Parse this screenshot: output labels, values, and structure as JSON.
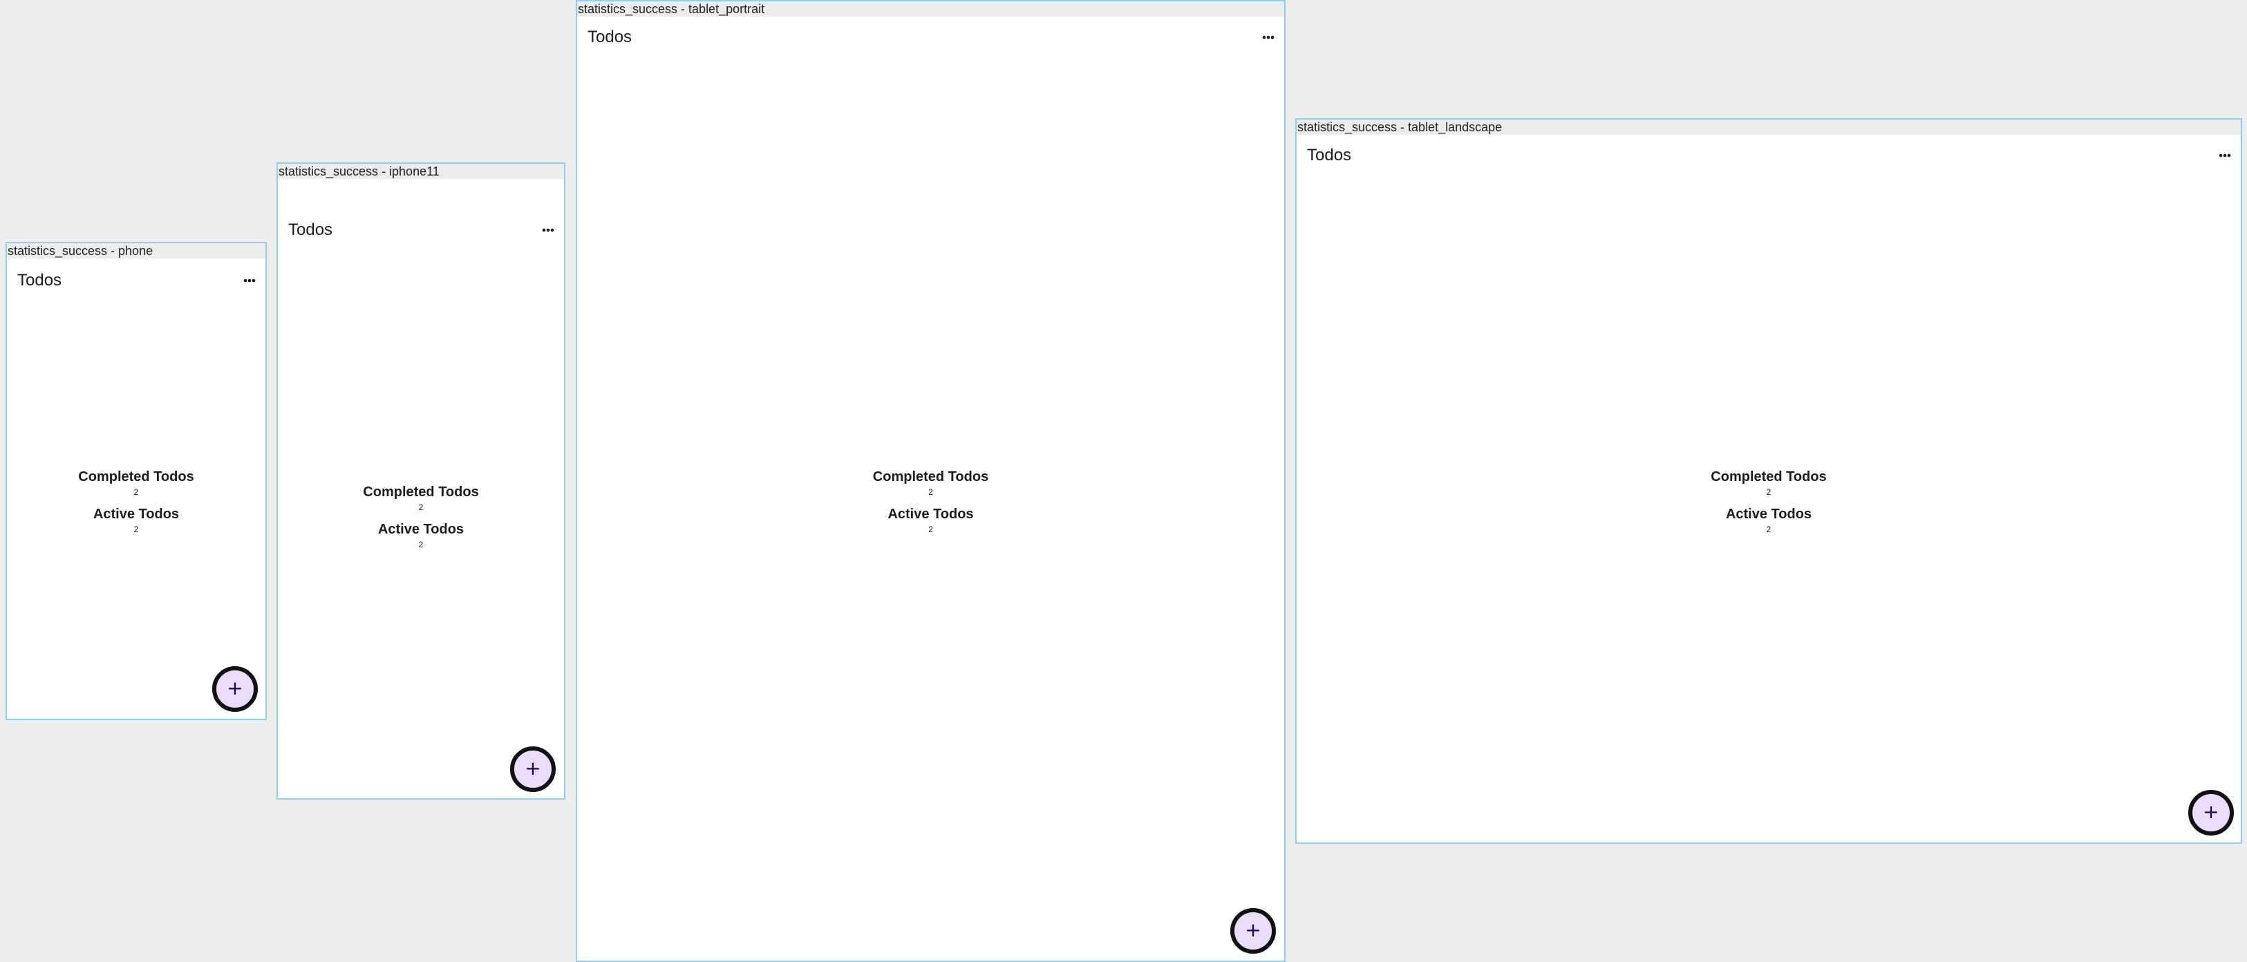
{
  "frames": [
    {
      "id": "phone",
      "label": "statistics_success - phone",
      "app_bar": {
        "title": "Todos",
        "menu_icon": "more-horizontal-icon"
      },
      "stats": {
        "completed_label": "Completed Todos",
        "completed_value": "2",
        "active_label": "Active Todos",
        "active_value": "2"
      },
      "fab": {
        "label": "+",
        "icon": "add-icon"
      }
    },
    {
      "id": "iphone11",
      "label": "statistics_success - iphone11",
      "app_bar": {
        "title": "Todos",
        "menu_icon": "more-horizontal-icon"
      },
      "stats": {
        "completed_label": "Completed Todos",
        "completed_value": "2",
        "active_label": "Active Todos",
        "active_value": "2"
      },
      "fab": {
        "label": "+",
        "icon": "add-icon"
      }
    },
    {
      "id": "tablet_portrait",
      "label": "statistics_success - tablet_portrait",
      "app_bar": {
        "title": "Todos",
        "menu_icon": "more-horizontal-icon"
      },
      "stats": {
        "completed_label": "Completed Todos",
        "completed_value": "2",
        "active_label": "Active Todos",
        "active_value": "2"
      },
      "fab": {
        "label": "+",
        "icon": "add-icon"
      }
    },
    {
      "id": "tablet_landscape",
      "label": "statistics_success - tablet_landscape",
      "app_bar": {
        "title": "Todos",
        "menu_icon": "more-horizontal-icon"
      },
      "stats": {
        "completed_label": "Completed Todos",
        "completed_value": "2",
        "active_label": "Active Todos",
        "active_value": "2"
      },
      "fab": {
        "label": "+",
        "icon": "add-icon"
      }
    }
  ],
  "colors": {
    "canvas_background": "#ededed",
    "frame_border": "#8fd0f2",
    "frame_label_background": "#ececec",
    "surface": "#ffffff",
    "fab_fill": "#eaddff",
    "fab_border": "#111111",
    "text": "#1c1b1f"
  }
}
